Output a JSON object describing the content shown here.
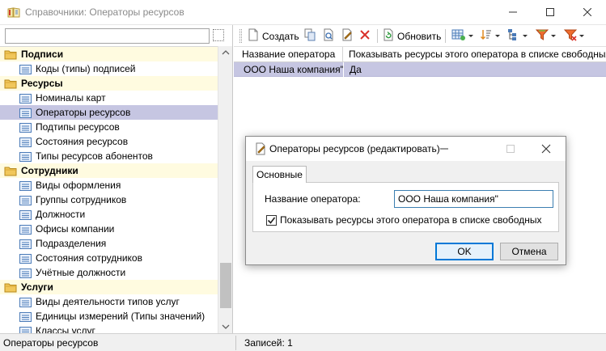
{
  "window": {
    "title": "Справочники: Операторы ресурсов"
  },
  "left_panel": {
    "search_value": "",
    "tree": [
      {
        "type": "group",
        "label": "Подписи"
      },
      {
        "type": "item",
        "label": "Коды (типы) подписей"
      },
      {
        "type": "group",
        "label": "Ресурсы"
      },
      {
        "type": "item",
        "label": "Номиналы карт"
      },
      {
        "type": "item",
        "label": "Операторы ресурсов",
        "selected": true
      },
      {
        "type": "item",
        "label": "Подтипы ресурсов"
      },
      {
        "type": "item",
        "label": "Состояния ресурсов"
      },
      {
        "type": "item",
        "label": "Типы ресурсов абонентов"
      },
      {
        "type": "group",
        "label": "Сотрудники"
      },
      {
        "type": "item",
        "label": "Виды оформления"
      },
      {
        "type": "item",
        "label": "Группы сотрудников"
      },
      {
        "type": "item",
        "label": "Должности"
      },
      {
        "type": "item",
        "label": "Офисы компании"
      },
      {
        "type": "item",
        "label": "Подразделения"
      },
      {
        "type": "item",
        "label": "Состояния сотрудников"
      },
      {
        "type": "item",
        "label": "Учётные должности"
      },
      {
        "type": "group",
        "label": "Услуги"
      },
      {
        "type": "item",
        "label": "Виды деятельности типов услуг"
      },
      {
        "type": "item",
        "label": "Единицы измерений (Типы значений)"
      },
      {
        "type": "item",
        "label": "Классы услуг"
      }
    ]
  },
  "toolbar": {
    "create_label": "Создать",
    "refresh_label": "Обновить",
    "icons": [
      "new-document-icon",
      "copy-icon",
      "view-icon",
      "edit-icon",
      "delete-icon",
      "refresh-icon",
      "grid-settings-icon",
      "sort-icon",
      "tree-icon",
      "filter-icon",
      "clear-filter-icon"
    ]
  },
  "grid": {
    "columns": [
      "Название оператора",
      "Показывать ресурсы этого оператора в списке свободных"
    ],
    "rows": [
      [
        "ООО Наша компания\"",
        "Да"
      ]
    ]
  },
  "status": {
    "left": "Операторы ресурсов",
    "right": "Записей: 1"
  },
  "dialog": {
    "title": "Операторы ресурсов (редактировать)",
    "tab": "Основные",
    "field_label": "Название оператора:",
    "field_value": "ООО Наша компания\"",
    "checkbox_label": "Показывать ресурсы этого оператора в списке свободных",
    "checkbox_checked": true,
    "ok_label": "OK",
    "cancel_label": "Отмена"
  },
  "colors": {
    "selection": "#c6c6e2",
    "group_background": "#fffbe0",
    "accent": "#0078d7"
  }
}
